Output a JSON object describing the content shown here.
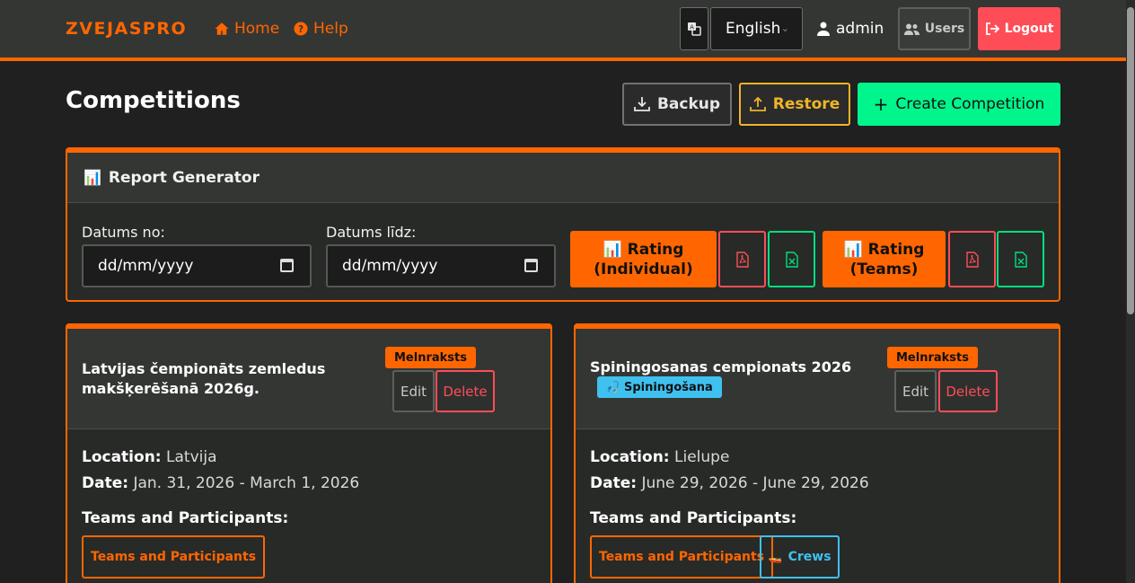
{
  "nav": {
    "brand": "ZVEJASPRO",
    "home": "Home",
    "help": "Help",
    "language": "English",
    "user": "admin",
    "users": "Users",
    "logout": "Logout"
  },
  "header": {
    "title": "Competitions",
    "backup": "Backup",
    "restore": "Restore",
    "create": "Create Competition"
  },
  "report": {
    "title": "Report Generator",
    "date_from_label": "Datums no:",
    "date_to_label": "Datums līdz:",
    "date_placeholder": "dd/mm/yyyy",
    "rating_individual_1": "Rating",
    "rating_individual_2": "(Individual)",
    "rating_teams_1": "Rating",
    "rating_teams_2": "(Teams)"
  },
  "competitions": [
    {
      "title_line1": "Latvijas čempionāts zemledus",
      "title_line2": "makšķerēšanā 2026g.",
      "status": "Melnraksts",
      "edit": "Edit",
      "delete": "Delete",
      "location_label": "Location:",
      "location": "Latvija",
      "date_label": "Date:",
      "date": "Jan. 31, 2026 - March 1, 2026",
      "teams_label": "Teams and Participants:",
      "teams_button": "Teams and Participants"
    },
    {
      "title_line1": "Spiningosanas cempionats 2026",
      "type": "Spiningošana",
      "status": "Melnraksts",
      "edit": "Edit",
      "delete": "Delete",
      "location_label": "Location:",
      "location": "Lielupe",
      "date_label": "Date:",
      "date": "June 29, 2026 - June 29, 2026",
      "teams_label": "Teams and Participants:",
      "teams_button": "Teams and Participants",
      "crews_button": "Crews"
    }
  ],
  "colors": {
    "accent": "#ff6600",
    "danger": "#ff4d57",
    "success": "#00f58c",
    "warning": "#f0b429",
    "info": "#3fc1f0"
  }
}
